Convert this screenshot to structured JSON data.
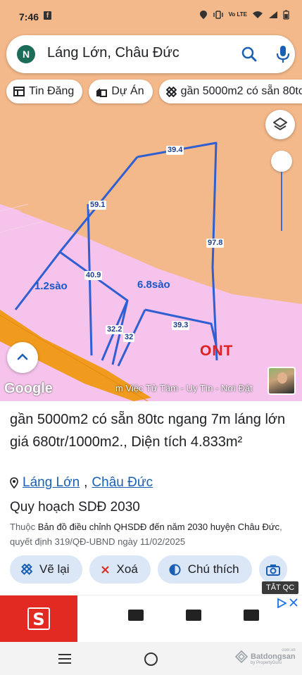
{
  "status_bar": {
    "time": "7:46",
    "fb_glyph": "f",
    "signal_text": "Vo LTE"
  },
  "search": {
    "avatar_initial": "N",
    "query": "Láng Lớn, Châu Đức"
  },
  "chips": [
    {
      "icon": "newspaper-icon",
      "label": "Tin Đăng"
    },
    {
      "icon": "building-icon",
      "label": "Dự Án"
    },
    {
      "icon": "ruler-icon",
      "label": "gần 5000m2 có sẵn 80tc"
    }
  ],
  "map": {
    "area_labels": {
      "left": "1.2sào",
      "right": "6.8sào"
    },
    "edge_labels": [
      "39.4",
      "59.1",
      "97.8",
      "40.9",
      "32.2",
      "32",
      "39.3"
    ],
    "zoning_label": "ONT",
    "google_logo": "Google",
    "ticker": "m Việc Tử Tâm - Uy Tín - Nơi Đặt"
  },
  "listing": {
    "title": "gần 5000m2 có sẵn 80tc ngang 7m láng lớn giá 680tr/1000m2., Diện tích 4.833m²",
    "location_ward": "Láng Lớn",
    "location_sep": ",",
    "location_district": "Châu Đức",
    "plan_title": "Quy hoạch SDĐ 2030",
    "plan_prefix": "Thuộc ",
    "plan_doc": "Bản đồ điều chỉnh QHSDĐ đến năm 2030 huyện Châu Đức",
    "plan_suffix": ", quyết định 319/QĐ-UBND ngày 11/02/2025"
  },
  "actions": [
    {
      "icon": "redraw-icon",
      "label": "Vẽ lại"
    },
    {
      "icon": "delete-x-icon",
      "label": "Xoá"
    },
    {
      "icon": "legend-icon",
      "label": "Chú thích"
    }
  ],
  "ad": {
    "tag": "TẮT QC",
    "logo_letter": "S"
  },
  "brand": {
    "name": "Batdongsan",
    "sub": "by PropertyGuru",
    "domain": "com.vn"
  },
  "colors": {
    "map_orange": "#f4b98a",
    "map_pink": "#f6c3ec",
    "road": "#f09a1e",
    "plot_line": "#2f5fd0",
    "action_bg": "#dbe6f7",
    "ont_red": "#e02020"
  }
}
